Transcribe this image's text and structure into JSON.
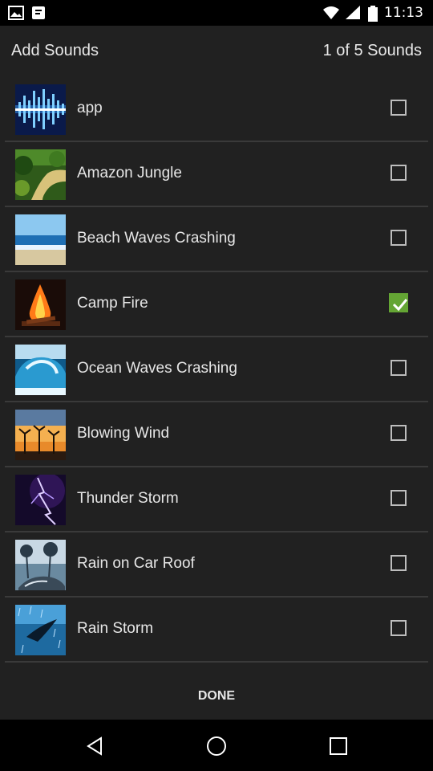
{
  "status_bar": {
    "time": "11:13",
    "icons": [
      "photo-icon",
      "notification-icon",
      "wifi-icon",
      "signal-icon",
      "battery-icon"
    ]
  },
  "dialog": {
    "title": "Add Sounds",
    "count_text": "1 of 5 Sounds",
    "done_label": "DONE"
  },
  "sounds": [
    {
      "label": "app",
      "checked": false
    },
    {
      "label": "Amazon Jungle",
      "checked": false
    },
    {
      "label": "Beach Waves Crashing",
      "checked": false
    },
    {
      "label": "Camp Fire",
      "checked": true
    },
    {
      "label": "Ocean Waves Crashing",
      "checked": false
    },
    {
      "label": "Blowing Wind",
      "checked": false
    },
    {
      "label": "Thunder Storm",
      "checked": false
    },
    {
      "label": "Rain on Car Roof",
      "checked": false
    },
    {
      "label": "Rain Storm",
      "checked": false
    }
  ],
  "nav": {
    "back": "back-icon",
    "home": "home-icon",
    "recents": "recents-icon"
  },
  "colors": {
    "dialog_bg": "#212121",
    "divider": "#3a3a3a",
    "check_accent": "#64a534"
  }
}
